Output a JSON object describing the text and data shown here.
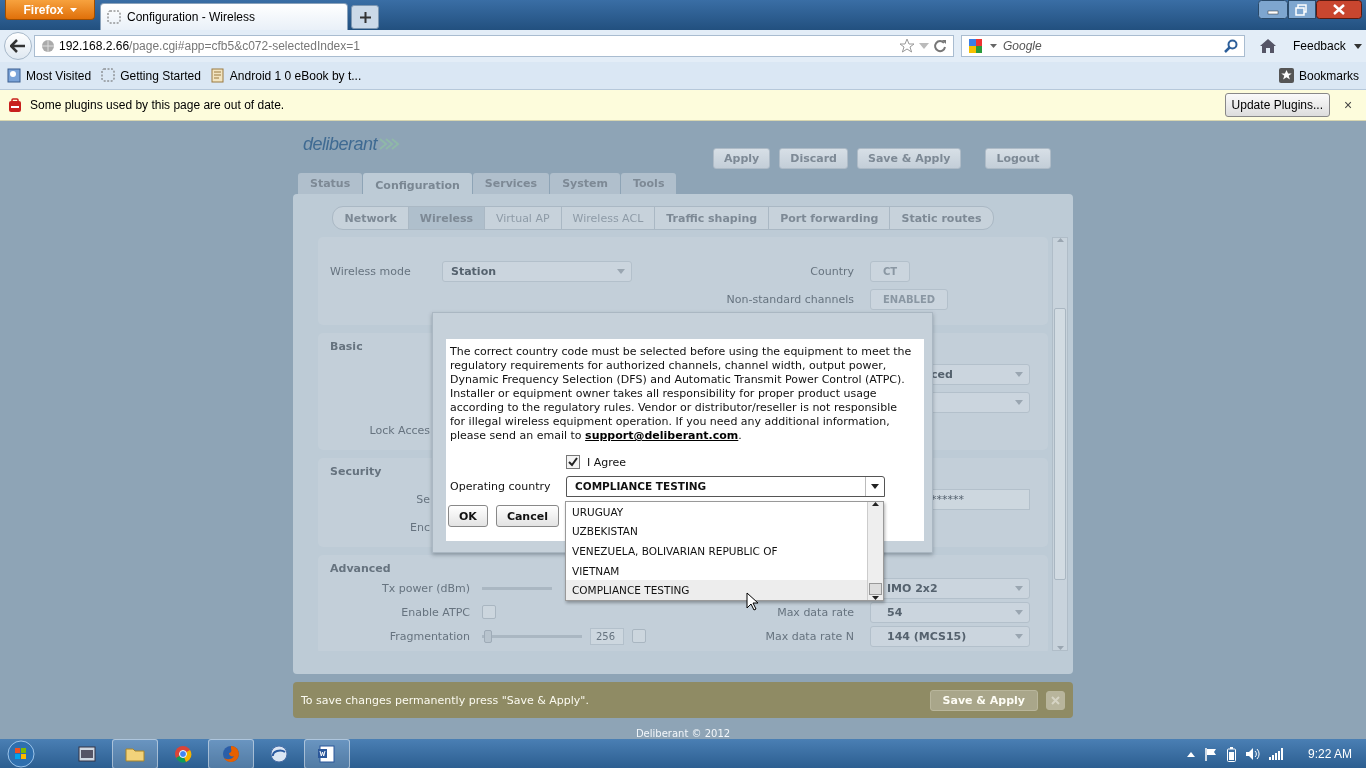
{
  "browser": {
    "menu_button": "Firefox",
    "tabs": [
      {
        "title": "Configuration - Wireless",
        "selected": true
      }
    ],
    "url": {
      "host": "192.168.2.66",
      "path": "/page.cgi#app=cfb5&c072-selectedIndex=1"
    },
    "search": {
      "placeholder": "Google"
    },
    "feedback": "Feedback",
    "bookmarks": [
      "Most Visited",
      "Getting Started",
      "Android 1 0 eBook by t..."
    ],
    "bookmarks_menu": "Bookmarks",
    "notification": {
      "message": "Some plugins used by this page are out of date.",
      "button": "Update Plugins...",
      "close": "×"
    }
  },
  "app": {
    "logo": "deliberant",
    "actions": [
      "Apply",
      "Discard",
      "Save & Apply",
      "Logout"
    ],
    "tabs": [
      {
        "label": "Status",
        "selected": false
      },
      {
        "label": "Configuration",
        "selected": true
      },
      {
        "label": "Services",
        "selected": false
      },
      {
        "label": "System",
        "selected": false
      },
      {
        "label": "Tools",
        "selected": false
      }
    ],
    "subtabs": [
      {
        "label": "Network",
        "selected": false,
        "disabled": false
      },
      {
        "label": "Wireless",
        "selected": true,
        "disabled": false
      },
      {
        "label": "Virtual AP",
        "selected": false,
        "disabled": true
      },
      {
        "label": "Wireless ACL",
        "selected": false,
        "disabled": true
      },
      {
        "label": "Traffic shaping",
        "selected": false,
        "disabled": false
      },
      {
        "label": "Port forwarding",
        "selected": false,
        "disabled": false
      },
      {
        "label": "Static routes",
        "selected": false,
        "disabled": false
      }
    ],
    "sections": [
      {
        "kind": "mode",
        "rows": [
          {
            "label": "Wireless mode",
            "control": {
              "kind": "select",
              "value": "Station"
            },
            "right_label": "Country",
            "right_control": {
              "kind": "button",
              "value": "CT"
            }
          },
          {
            "right_label": "Non-standard channels",
            "right_control": {
              "kind": "button",
              "value": "ENABLED"
            }
          }
        ]
      },
      {
        "kind": "basic",
        "heading": "Basic",
        "rows": [
          {
            "right_control": {
              "kind": "select",
              "value": "ced"
            }
          },
          {
            "right_control": {
              "kind": "select"
            }
          },
          {
            "label": "Lock Acces"
          }
        ]
      },
      {
        "kind": "basic",
        "heading": "Security",
        "rows": [
          {
            "label": "Se",
            "right_control": {
              "kind": "password",
              "value": "******"
            }
          },
          {
            "label": "Enc"
          }
        ]
      },
      {
        "kind": "advanced",
        "heading": "Advanced",
        "rows": [
          {
            "label": "Tx power (dBm)",
            "control": {
              "kind": "slider"
            },
            "right_control": {
              "kind": "select",
              "value": "IMO 2x2"
            }
          },
          {
            "label": "Enable ATPC",
            "control": {
              "kind": "checkbox",
              "checked": false
            },
            "right_label": "Max data rate",
            "right_control": {
              "kind": "select",
              "value": "54"
            }
          },
          {
            "label": "Fragmentation",
            "control": {
              "kind": "fragmentation",
              "level": 0.02,
              "value": "256",
              "checked": false
            },
            "right_label": "Max data rate N",
            "right_control": {
              "kind": "select",
              "value": "144 (MCS15)"
            }
          }
        ]
      }
    ],
    "footer": {
      "message": "To save changes permanently press \"Save & Apply\".",
      "button": {
        "label": "Save & Apply",
        "disabled": true
      }
    },
    "copyright": "Deliberant © 2012"
  },
  "dialog": {
    "text": "The correct country code must be selected before using the equipment to meet the regulatory requirements for authorized channels, channel width, output power, Dynamic Frequency Selection (DFS) and Automatic Transmit Power Control (ATPC). Installer or equipment owner takes all responsibility for proper product usage according to the regulatory rules. Vendor or distributor/reseller is not responsible for illegal wireless equipment operation. If you need any additional information, please send an email to ",
    "email": "support@deliberant.com",
    "text_end": ".",
    "agree": {
      "label": "I Agree",
      "checked": true
    },
    "country": {
      "label": "Operating country",
      "value": "COMPLIANCE TESTING",
      "expanded": true,
      "options": [
        {
          "label": "URUGUAY",
          "selected": false
        },
        {
          "label": "UZBEKISTAN",
          "selected": false
        },
        {
          "label": "VENEZUELA, BOLIVARIAN REPUBLIC OF",
          "selected": false
        },
        {
          "label": "VIETNAM",
          "selected": false
        },
        {
          "label": "COMPLIANCE TESTING",
          "selected": true
        }
      ]
    },
    "buttons": [
      "OK",
      "Cancel"
    ]
  },
  "taskbar": {
    "apps": [
      {
        "kind": "media",
        "open": false
      },
      {
        "kind": "folder",
        "open": true
      },
      {
        "kind": "chrome",
        "open": false
      },
      {
        "kind": "firefox",
        "open": true
      },
      {
        "kind": "globe",
        "open": false
      },
      {
        "kind": "word",
        "open": true
      }
    ],
    "time": "9:22 AM"
  }
}
